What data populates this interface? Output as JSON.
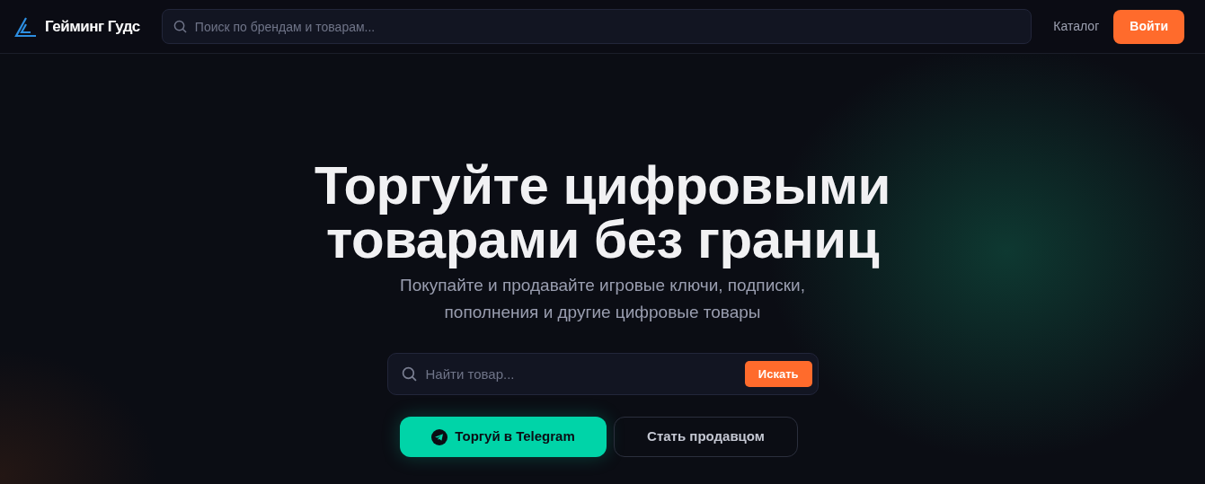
{
  "header": {
    "brand": "Гейминг Гудс",
    "search": {
      "placeholder": "Поиск по брендам и товарам..."
    },
    "links": [
      {
        "label": "Каталог"
      }
    ],
    "login_button": "Войти"
  },
  "hero": {
    "title_lines": [
      "Торгуйте цифровыми",
      "товарами без границ"
    ],
    "subtitle_lines": [
      "Покупайте и продавайте игровые ключи, подписки,",
      "пополнения и другие цифровые товары"
    ],
    "search": {
      "placeholder": "Найти товар...",
      "button": "Искать"
    },
    "buttons": [
      {
        "label": "Торгуй в Telegram",
        "kind": "primary"
      },
      {
        "label": "Стать продавцом",
        "kind": "outline"
      }
    ]
  }
}
